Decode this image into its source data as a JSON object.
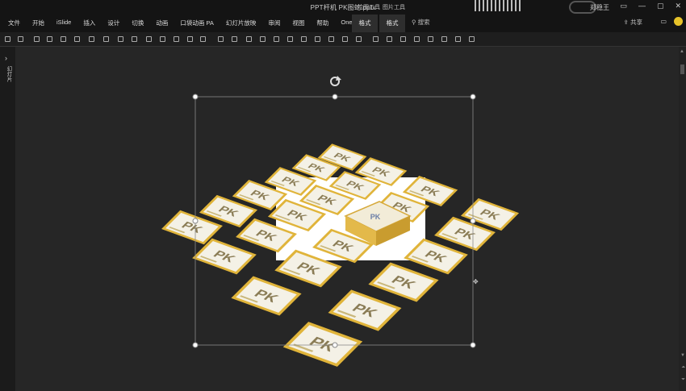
{
  "window": {
    "title": "PPT杆机 PK图蛇.pptx",
    "user": "郑稳王",
    "share_label": "共享"
  },
  "ribbon": {
    "tabs": [
      "文件",
      "开始",
      "iSlide",
      "插入",
      "设计",
      "切换",
      "动画",
      "口袋动画 PA",
      "幻灯片放映",
      "审阅",
      "视图",
      "帮助",
      "OneKey 7"
    ],
    "context_groups": [
      "绘图工具",
      "图片工具"
    ],
    "context_tabs": [
      "格式",
      "格式"
    ],
    "search_placeholder": "搜索"
  },
  "sidebar": {
    "label": "幻灯片"
  },
  "slide": {
    "card_text": "PK",
    "rotate_handle": "rotate-icon",
    "selected": true
  },
  "colors": {
    "card_border": "#e0b43a",
    "card_face": "#f4f1e6",
    "background": "#262626",
    "white_panel": "#ffffff",
    "box_yellow": "#e3b94a"
  }
}
